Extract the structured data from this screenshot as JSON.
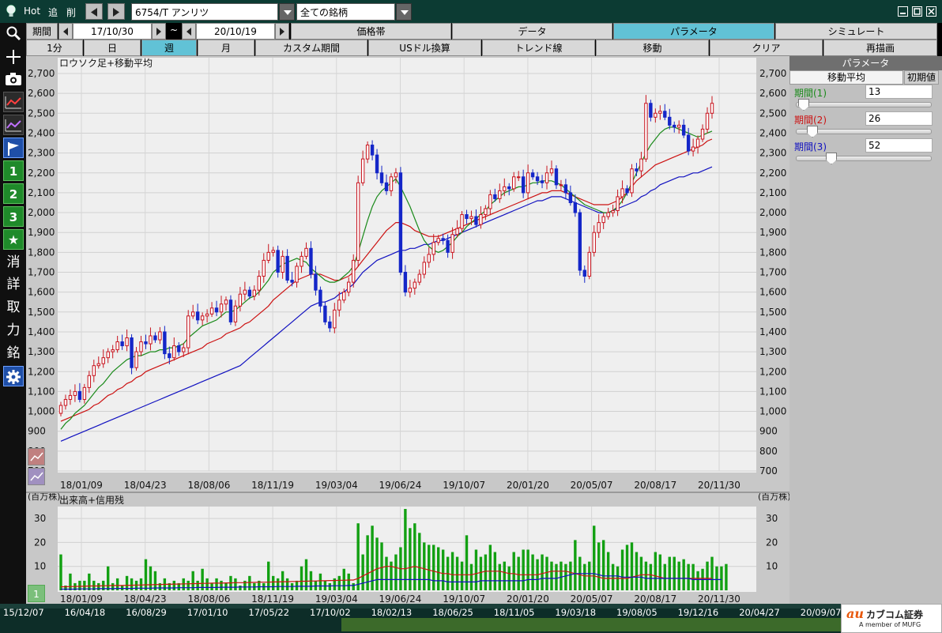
{
  "titlebar": {
    "hot_label": "Hot",
    "add_label": "追",
    "del_label": "削",
    "symbol": "6754/T アンリツ",
    "list": "全ての銘柄"
  },
  "toolbar_row1": {
    "period_label": "期間",
    "date_from": "17/10/30",
    "tilde": "~",
    "date_to": "20/10/19",
    "tabs": [
      "価格帯",
      "データ",
      "パラメータ",
      "シミュレート"
    ],
    "active_tab": "パラメータ"
  },
  "toolbar_row2": {
    "intervals": [
      "1分",
      "日",
      "週",
      "月",
      "カスタム期間",
      "USドル換算"
    ],
    "active_interval": "週",
    "actions": [
      "トレンド線",
      "移動",
      "クリア",
      "再描画"
    ]
  },
  "left_tools": {
    "num1": "1",
    "num2": "2",
    "num3": "3",
    "erase": "消",
    "detail": "詳",
    "trade": "取",
    "power": "力",
    "brand": "銘"
  },
  "param_panel": {
    "title": "パラメータ",
    "tab_ma": "移動平均",
    "tab_init": "初期値",
    "p1_label": "期間(1)",
    "p1_value": "13",
    "p2_label": "期間(2)",
    "p2_value": "26",
    "p3_label": "期間(3)",
    "p3_value": "52",
    "p1_color": "#1a8a1a",
    "p2_color": "#cc1111",
    "p3_color": "#1010c0"
  },
  "bottom_timeline": [
    "15/12/07",
    "16/04/18",
    "16/08/29",
    "17/01/10",
    "17/05/22",
    "17/10/02",
    "18/02/13",
    "18/06/25",
    "18/11/05",
    "19/03/18",
    "19/08/05",
    "19/12/16",
    "20/04/27",
    "20/09/07"
  ],
  "logo": {
    "brand": "カブコム証券",
    "sub": "A member of MUFG"
  },
  "chart_data": [
    {
      "type": "candlestick",
      "title": "ロウソク足+移動平均",
      "ylim": [
        700,
        2700
      ],
      "y_ticks": [
        "700",
        "800",
        "900",
        "1,000",
        "1,100",
        "1,200",
        "1,300",
        "1,400",
        "1,500",
        "1,600",
        "1,700",
        "1,800",
        "1,900",
        "2,000",
        "2,100",
        "2,200",
        "2,300",
        "2,400",
        "2,500",
        "2,600",
        "2,700"
      ],
      "x_ticks": [
        "18/01/09",
        "18/04/23",
        "18/08/06",
        "18/11/19",
        "19/03/04",
        "19/06/24",
        "19/10/07",
        "20/01/20",
        "20/05/07",
        "20/08/17",
        "20/11/30"
      ],
      "up_color": "#c8141e",
      "down_color": "#1426c8",
      "close": [
        1030,
        1060,
        1080,
        1100,
        1060,
        1120,
        1180,
        1230,
        1240,
        1270,
        1300,
        1310,
        1350,
        1330,
        1370,
        1220,
        1300,
        1350,
        1340,
        1380,
        1360,
        1400,
        1290,
        1270,
        1330,
        1300,
        1320,
        1480,
        1500,
        1460,
        1480,
        1490,
        1520,
        1500,
        1540,
        1560,
        1450,
        1530,
        1590,
        1610,
        1580,
        1610,
        1680,
        1760,
        1800,
        1810,
        1700,
        1780,
        1660,
        1650,
        1730,
        1780,
        1820,
        1690,
        1610,
        1530,
        1450,
        1420,
        1510,
        1560,
        1600,
        1650,
        1760,
        2150,
        2270,
        2340,
        2290,
        2200,
        2150,
        2110,
        2180,
        2200,
        1700,
        1600,
        1620,
        1650,
        1690,
        1750,
        1790,
        1850,
        1870,
        1860,
        1800,
        1890,
        1920,
        1990,
        1970,
        1980,
        1940,
        1990,
        2020,
        2090,
        2070,
        2110,
        2130,
        2120,
        2180,
        2180,
        2100,
        2200,
        2180,
        2160,
        2150,
        2200,
        2220,
        2140,
        2140,
        2100,
        2050,
        2000,
        1710,
        1680,
        1800,
        1900,
        1950,
        1980,
        2000,
        2010,
        2080,
        2120,
        2100,
        2220,
        2210,
        2270,
        2550,
        2480,
        2500,
        2510,
        2480,
        2440,
        2430,
        2440,
        2390,
        2310,
        2330,
        2370,
        2420,
        2500,
        2550
      ],
      "ma13": [
        910,
        940,
        960,
        990,
        1010,
        1030,
        1060,
        1090,
        1120,
        1140,
        1170,
        1200,
        1220,
        1240,
        1260,
        1270,
        1280,
        1280,
        1290,
        1300,
        1300,
        1310,
        1310,
        1320,
        1320,
        1330,
        1340,
        1370,
        1390,
        1410,
        1430,
        1440,
        1450,
        1460,
        1480,
        1500,
        1500,
        1510,
        1530,
        1550,
        1570,
        1580,
        1600,
        1630,
        1660,
        1700,
        1720,
        1740,
        1750,
        1760,
        1770,
        1760,
        1750,
        1720,
        1700,
        1680,
        1660,
        1650,
        1650,
        1660,
        1680,
        1700,
        1730,
        1800,
        1880,
        1960,
        2030,
        2080,
        2110,
        2130,
        2150,
        2170,
        2130,
        2080,
        2030,
        1970,
        1910,
        1860,
        1830,
        1810,
        1800,
        1810,
        1830,
        1850,
        1880,
        1900,
        1930,
        1950,
        1970,
        1990,
        2010,
        2040,
        2060,
        2080,
        2100,
        2110,
        2120,
        2130,
        2130,
        2140,
        2150,
        2150,
        2160,
        2160,
        2160,
        2150,
        2140,
        2120,
        2100,
        2080,
        2060,
        2040,
        2030,
        2020,
        2010,
        2000,
        2000,
        2010,
        2030,
        2060,
        2100,
        2150,
        2200,
        2250,
        2300,
        2340,
        2370,
        2400,
        2420,
        2430,
        2430,
        2420,
        2410,
        2400,
        2390,
        2380,
        2390,
        2400,
        2410
      ],
      "ma26": [
        950,
        960,
        970,
        980,
        990,
        1000,
        1010,
        1030,
        1040,
        1060,
        1080,
        1090,
        1110,
        1120,
        1140,
        1150,
        1170,
        1180,
        1200,
        1210,
        1220,
        1230,
        1240,
        1250,
        1260,
        1270,
        1280,
        1290,
        1300,
        1310,
        1320,
        1340,
        1350,
        1360,
        1370,
        1390,
        1400,
        1410,
        1420,
        1440,
        1450,
        1470,
        1490,
        1510,
        1530,
        1560,
        1580,
        1600,
        1620,
        1640,
        1660,
        1670,
        1680,
        1690,
        1690,
        1690,
        1680,
        1670,
        1660,
        1660,
        1670,
        1680,
        1700,
        1730,
        1760,
        1790,
        1820,
        1850,
        1880,
        1910,
        1930,
        1950,
        1950,
        1940,
        1930,
        1910,
        1900,
        1890,
        1880,
        1880,
        1880,
        1890,
        1900,
        1910,
        1920,
        1930,
        1940,
        1950,
        1960,
        1970,
        1980,
        1990,
        2000,
        2010,
        2020,
        2030,
        2040,
        2050,
        2060,
        2070,
        2080,
        2090,
        2100,
        2100,
        2110,
        2110,
        2110,
        2100,
        2090,
        2080,
        2070,
        2060,
        2050,
        2040,
        2040,
        2040,
        2040,
        2050,
        2060,
        2080,
        2100,
        2130,
        2160,
        2180,
        2200,
        2220,
        2240,
        2250,
        2260,
        2270,
        2280,
        2290,
        2300,
        2310,
        2320,
        2330,
        2340,
        2360,
        2370
      ],
      "ma52": [
        850,
        860,
        870,
        880,
        890,
        900,
        910,
        920,
        930,
        940,
        950,
        960,
        970,
        980,
        990,
        1000,
        1010,
        1020,
        1030,
        1040,
        1050,
        1060,
        1070,
        1080,
        1090,
        1100,
        1110,
        1120,
        1130,
        1140,
        1150,
        1160,
        1170,
        1180,
        1190,
        1200,
        1210,
        1220,
        1230,
        1250,
        1270,
        1290,
        1310,
        1330,
        1350,
        1370,
        1390,
        1410,
        1430,
        1450,
        1470,
        1490,
        1510,
        1530,
        1540,
        1550,
        1550,
        1560,
        1570,
        1590,
        1600,
        1620,
        1640,
        1670,
        1700,
        1720,
        1740,
        1760,
        1770,
        1780,
        1790,
        1800,
        1810,
        1810,
        1820,
        1820,
        1830,
        1840,
        1840,
        1850,
        1860,
        1860,
        1870,
        1880,
        1890,
        1900,
        1910,
        1920,
        1930,
        1940,
        1950,
        1960,
        1970,
        1980,
        1990,
        2000,
        2010,
        2020,
        2030,
        2040,
        2050,
        2060,
        2060,
        2070,
        2080,
        2080,
        2080,
        2070,
        2060,
        2050,
        2040,
        2030,
        2020,
        2010,
        2000,
        2000,
        2000,
        2010,
        2020,
        2030,
        2040,
        2050,
        2060,
        2080,
        2090,
        2110,
        2120,
        2140,
        2150,
        2160,
        2170,
        2180,
        2180,
        2190,
        2200,
        2200,
        2210,
        2220,
        2230
      ]
    },
    {
      "type": "bar",
      "title": "出来高+信用残",
      "unit": "(百万株)",
      "ylim": [
        0,
        35
      ],
      "y_ticks": [
        "10",
        "20",
        "30"
      ],
      "x_ticks": [
        "18/01/09",
        "18/04/23",
        "18/08/06",
        "18/11/19",
        "19/03/04",
        "19/06/24",
        "19/10/07",
        "20/01/20",
        "20/05/07",
        "20/08/17",
        "20/11/30"
      ],
      "values": [
        15,
        2,
        7,
        3,
        4,
        4,
        7,
        4,
        3,
        4,
        10,
        3,
        5,
        2,
        6,
        5,
        4,
        5,
        13,
        10,
        8,
        3,
        5,
        3,
        4,
        3,
        5,
        4,
        8,
        4,
        9,
        5,
        3,
        5,
        4,
        3,
        6,
        5,
        2,
        4,
        6,
        3,
        4,
        3,
        12,
        6,
        5,
        8,
        5,
        3,
        4,
        10,
        13,
        8,
        4,
        7,
        4,
        3,
        5,
        6,
        9,
        7,
        3,
        28,
        15,
        23,
        27,
        22,
        20,
        14,
        12,
        15,
        18,
        34,
        26,
        28,
        24,
        20,
        19,
        19,
        18,
        17,
        14,
        16,
        14,
        12,
        23,
        11,
        17,
        14,
        15,
        19,
        16,
        11,
        12,
        10,
        16,
        14,
        17,
        17,
        15,
        13,
        15,
        14,
        12,
        11,
        12,
        11,
        12,
        21,
        14,
        11,
        12,
        27,
        20,
        21,
        16,
        11,
        10,
        17,
        19,
        20,
        16,
        14,
        12,
        11,
        16,
        15,
        11,
        14,
        14,
        12,
        13,
        11,
        11,
        8,
        9,
        12,
        14,
        10,
        10,
        11
      ],
      "margin_line_1": [
        1.5,
        1.5,
        1.6,
        1.6,
        1.7,
        1.7,
        1.8,
        1.8,
        1.8,
        1.9,
        1.9,
        2,
        2,
        2,
        2.1,
        2.1,
        2.2,
        2.2,
        2.3,
        2.3,
        2.4,
        2.4,
        2.5,
        2.5,
        2.6,
        2.6,
        2.7,
        2.7,
        2.8,
        2.8,
        2.9,
        2.9,
        3,
        3,
        3,
        3.1,
        3.1,
        3.2,
        3.2,
        3.2,
        3.3,
        3.3,
        3.4,
        3.4,
        3.4,
        3.5,
        3.5,
        3.6,
        3.6,
        3.7,
        3.7,
        3.8,
        3.8,
        3.9,
        3.9,
        4,
        4,
        4.1,
        4.1,
        4.2,
        4.2,
        4.3,
        4.3,
        5,
        6,
        7,
        8,
        9,
        9.5,
        10,
        10,
        9.5,
        9,
        9,
        9.5,
        10,
        9.5,
        9,
        8.5,
        8,
        7.5,
        7,
        7,
        6.5,
        6.5,
        6.5,
        6.5,
        6.5,
        7,
        7.5,
        8,
        8,
        8,
        8,
        7.5,
        7,
        7,
        6.5,
        6.5,
        6.5,
        6.5,
        6.5,
        7,
        7.5,
        8,
        8,
        8,
        8,
        7.5,
        7,
        6.5,
        6,
        6,
        6,
        5.5,
        5,
        5,
        5,
        5,
        5,
        5,
        5.5,
        6,
        6.5,
        6.5,
        6.5,
        6,
        5.5,
        5,
        5,
        5,
        5,
        5,
        5,
        5,
        5,
        5,
        5,
        5
      ],
      "margin_line_2": [
        0.5,
        0.5,
        0.5,
        0.5,
        0.6,
        0.6,
        0.6,
        0.6,
        0.7,
        0.7,
        0.7,
        0.7,
        0.8,
        0.8,
        0.8,
        0.8,
        0.9,
        0.9,
        0.9,
        0.9,
        1,
        1,
        1,
        1,
        1,
        1.1,
        1.1,
        1.1,
        1.1,
        1.2,
        1.2,
        1.2,
        1.2,
        1.2,
        1.3,
        1.3,
        1.3,
        1.3,
        1.4,
        1.4,
        1.4,
        1.4,
        1.5,
        1.5,
        1.5,
        1.5,
        1.6,
        1.6,
        1.6,
        1.6,
        1.7,
        1.7,
        1.7,
        1.7,
        1.8,
        1.8,
        1.8,
        1.8,
        1.9,
        1.9,
        1.9,
        2,
        2,
        2.5,
        3,
        3.5,
        4,
        4.5,
        4.5,
        4.5,
        4.5,
        4.5,
        4.5,
        4.5,
        4.5,
        4.5,
        4.5,
        4.5,
        4.5,
        4,
        4,
        4,
        3.5,
        3.5,
        3.5,
        3.5,
        3.5,
        3.5,
        3.5,
        4,
        4,
        4,
        4,
        4,
        4,
        4,
        4,
        4,
        4,
        4.5,
        4.5,
        4.5,
        5,
        5,
        5,
        5,
        5.5,
        6,
        6.5,
        7,
        7,
        7,
        7,
        7,
        6.5,
        6,
        6,
        6,
        6,
        5.5,
        5.5,
        5.5,
        5.5,
        5.5,
        5,
        5,
        5,
        5,
        5,
        5,
        5,
        5,
        5,
        5,
        4.5,
        4.5,
        4.5,
        4.5,
        4.5,
        4.5,
        4.5
      ]
    }
  ]
}
